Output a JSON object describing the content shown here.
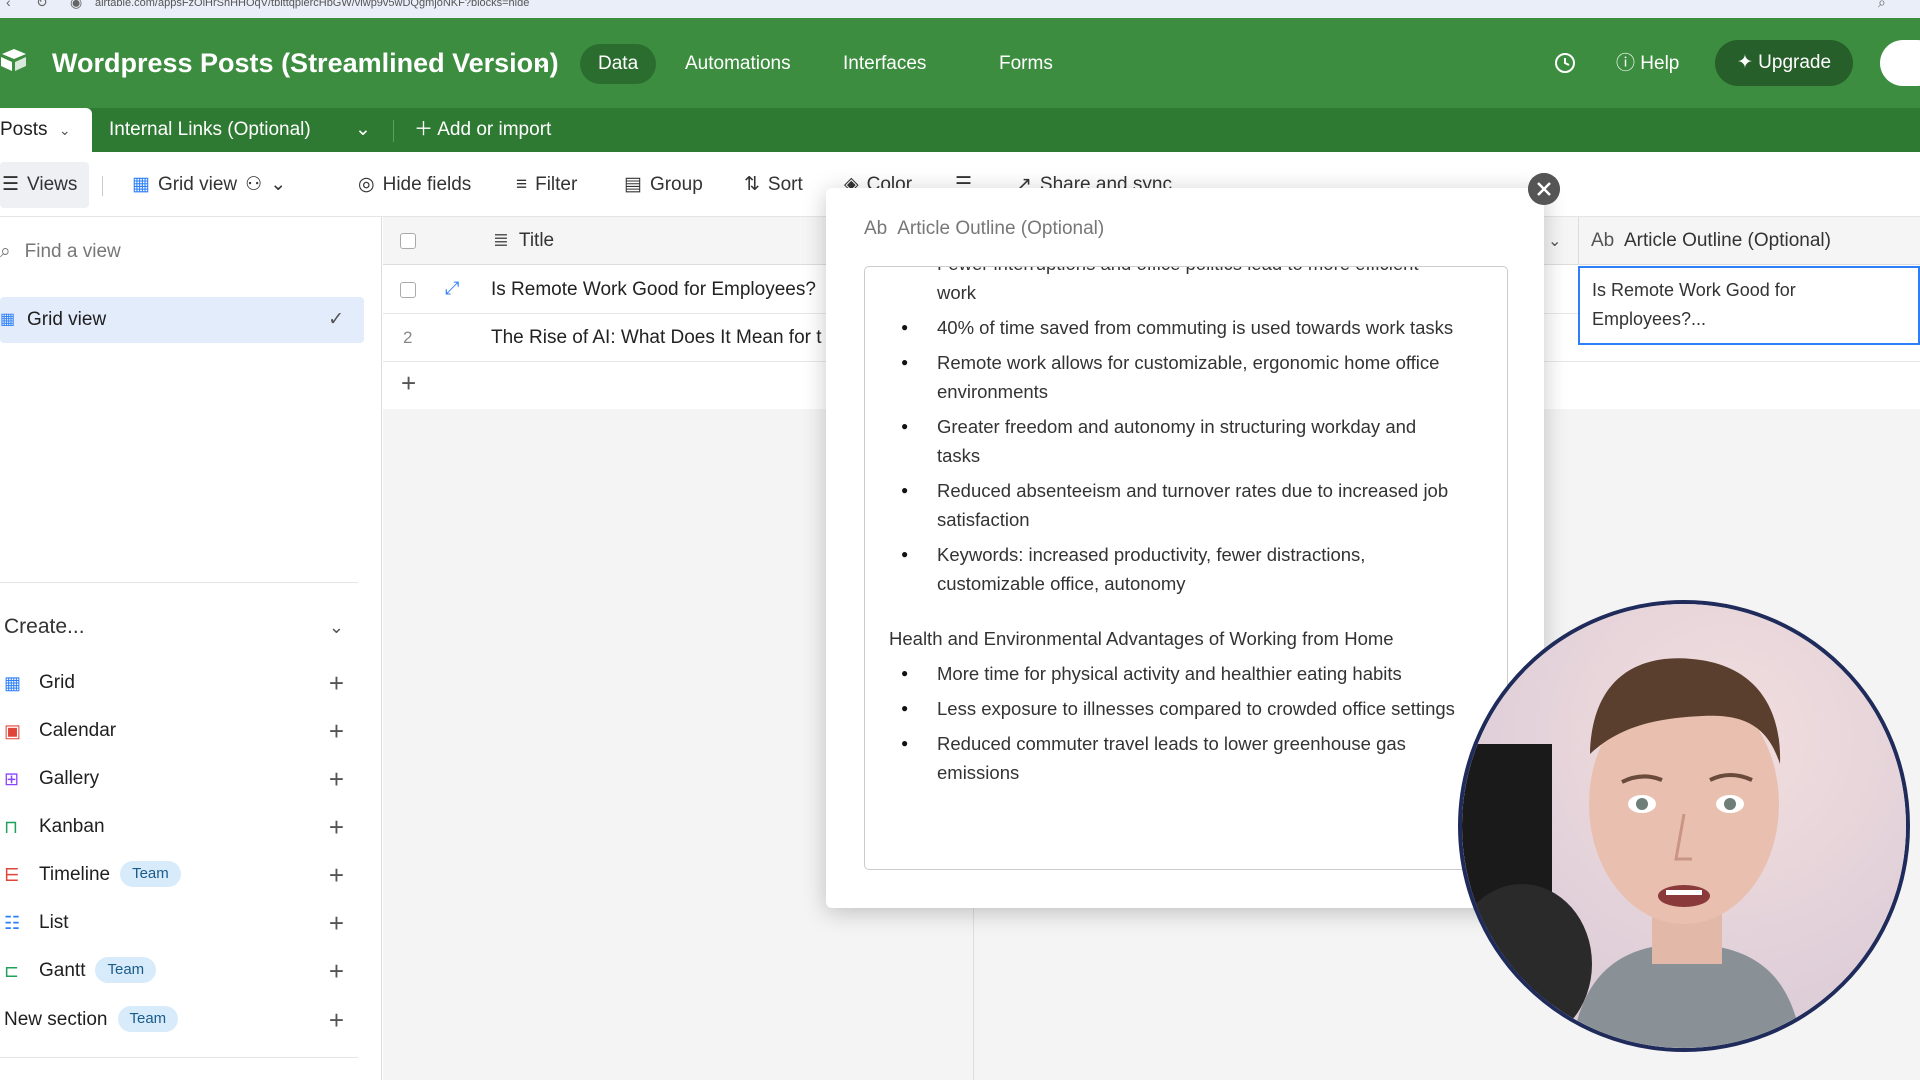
{
  "browser": {
    "url": "airtable.com/appsFzOlHrShHHOqV/tblttqplercHbGW/viwp9v5wDQgmjoNKF?blocks=hide"
  },
  "header": {
    "base_name": "Wordpress Posts (Streamlined Version)",
    "nav": [
      "Data",
      "Automations",
      "Interfaces",
      "Forms"
    ],
    "help": "Help",
    "upgrade": "Upgrade"
  },
  "tables": {
    "active": "Posts",
    "other": "Internal Links (Optional)",
    "add": "Add or import"
  },
  "toolbar": {
    "views": "Views",
    "grid_view": "Grid view",
    "hide_fields": "Hide fields",
    "filter": "Filter",
    "group": "Group",
    "sort": "Sort",
    "color": "Color",
    "share": "Share and sync"
  },
  "sidebar": {
    "find_placeholder": "Find a view",
    "active_view": "Grid view",
    "create_label": "Create...",
    "items": [
      {
        "label": "Grid",
        "icon": "grid-icon",
        "badge": ""
      },
      {
        "label": "Calendar",
        "icon": "calendar-icon",
        "badge": ""
      },
      {
        "label": "Gallery",
        "icon": "gallery-icon",
        "badge": ""
      },
      {
        "label": "Kanban",
        "icon": "kanban-icon",
        "badge": ""
      },
      {
        "label": "Timeline",
        "icon": "timeline-icon",
        "badge": "Team"
      },
      {
        "label": "List",
        "icon": "list-icon",
        "badge": ""
      },
      {
        "label": "Gantt",
        "icon": "gantt-icon",
        "badge": "Team"
      },
      {
        "label": "New section",
        "icon": "",
        "badge": "Team"
      }
    ]
  },
  "grid": {
    "title_column": "Title",
    "rows": [
      {
        "num": "",
        "title": "Is Remote Work Good for Employees?"
      },
      {
        "num": "2",
        "title": "The Rise of AI: What Does It Mean for t"
      }
    ],
    "outline_column": "Article Outline (Optional)",
    "outline_cell": "Is Remote Work Good for Employees?..."
  },
  "popup": {
    "field_name": "Article Outline (Optional)",
    "partial_line": "Fewer interruptions and office politics lead to more efficient work",
    "bullets_1": [
      "40% of time saved from commuting is used towards work tasks",
      "Remote work allows for customizable, ergonomic home office environments",
      "Greater freedom and autonomy in structuring workday and tasks",
      "Reduced absenteeism and turnover rates due to increased job satisfaction",
      "Keywords: increased productivity, fewer distractions, customizable office, autonomy"
    ],
    "heading_2": "Health and Environmental Advantages of Working from Home",
    "bullets_2": [
      "More time for physical activity and healthier eating habits",
      "Less exposure to illnesses compared to crowded office settings",
      "Reduced commuter travel leads to lower greenhouse gas emissions"
    ]
  },
  "colors": {
    "header_green": "#3d8d40",
    "tables_green": "#2f7a33",
    "accent_blue": "#2d7ff9"
  }
}
